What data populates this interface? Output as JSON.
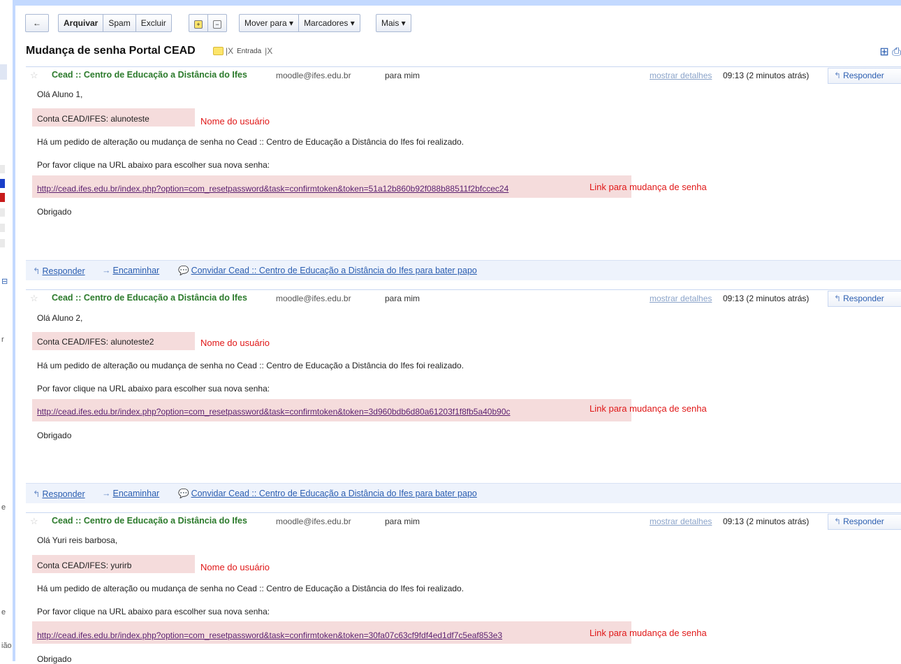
{
  "nav_fragments": [
    "ião",
    "e",
    "e",
    "r"
  ],
  "toolbar": {
    "back_glyph": "←",
    "archive": "Arquivar",
    "spam": "Spam",
    "delete": "Excluir",
    "expand_glyph": "+",
    "collapse_glyph": "−",
    "move_to": "Mover para ▾",
    "labels": "Marcadores ▾",
    "more": "Mais ▾"
  },
  "thread": {
    "subject": "Mudança de senha Portal CEAD",
    "label_x": "|X",
    "inbox_chip": "Entrada",
    "inbox_x": "|X",
    "view_icons": "⊞ ⎙"
  },
  "messages": [
    {
      "sender": "Cead :: Centro de Educação a Distância do Ifes",
      "email": "moodle@ifes.edu.br",
      "to": "para mim",
      "details": "mostrar detalhes",
      "time": "09:13 (2 minutos atrás)",
      "reply": "Responder",
      "greeting": "Olá Aluno 1,",
      "account": "Conta CEAD/IFES:  alunoteste",
      "account_note": "Nome do usuário",
      "request_text": "Há um pedido de alteração ou mudança de senha no Cead :: Centro de Educação a Distância do Ifes foi realizado.",
      "instruction": "Por favor clique na URL abaixo para escolher sua nova senha:",
      "link": "http://cead.ifes.edu.br/index.php?option=com_resetpassword&task=confirmtoken&token=51a12b860b92f088b88511f2bfccec24",
      "link_note": "Link para mudança de senha",
      "closing": "Obrigado",
      "footer_reply": "Responder",
      "footer_forward": "Encaminhar",
      "footer_chat": "Convidar Cead :: Centro de Educação a Distância do Ifes para bater papo"
    },
    {
      "sender": "Cead :: Centro de Educação a Distância do Ifes",
      "email": "moodle@ifes.edu.br",
      "to": "para mim",
      "details": "mostrar detalhes",
      "time": "09:13 (2 minutos atrás)",
      "reply": "Responder",
      "greeting": "Olá Aluno 2,",
      "account": "Conta CEAD/IFES:  alunoteste2",
      "account_note": "Nome do usuário",
      "request_text": "Há um pedido de alteração ou mudança de senha no Cead :: Centro de Educação a Distância do Ifes foi realizado.",
      "instruction": "Por favor clique na URL abaixo para escolher sua nova senha:",
      "link": "http://cead.ifes.edu.br/index.php?option=com_resetpassword&task=confirmtoken&token=3d960bdb6d80a61203f1f8fb5a40b90c",
      "link_note": "Link para mudança de senha",
      "closing": "Obrigado",
      "footer_reply": "Responder",
      "footer_forward": "Encaminhar",
      "footer_chat": "Convidar Cead :: Centro de Educação a Distância do Ifes para bater papo"
    },
    {
      "sender": "Cead :: Centro de Educação a Distância do Ifes",
      "email": "moodle@ifes.edu.br",
      "to": "para mim",
      "details": "mostrar detalhes",
      "time": "09:13 (2 minutos atrás)",
      "reply": "Responder",
      "greeting": "Olá Yuri reis barbosa,",
      "account": "Conta CEAD/IFES:  yurirb",
      "account_note": "Nome do usuário",
      "request_text": "Há um pedido de alteração ou mudança de senha no Cead :: Centro de Educação a Distância do Ifes foi realizado.",
      "instruction": "Por favor clique na URL abaixo para escolher sua nova senha:",
      "link": "http://cead.ifes.edu.br/index.php?option=com_resetpassword&task=confirmtoken&token=30fa07c63cf9fdf4ed1df7c5eaf853e3",
      "link_note": "Link para mudança de senha",
      "closing": "Obrigado"
    }
  ],
  "colors": {
    "accent_blue": "#c3d9ff",
    "sender_green": "#2b7a2b",
    "annotation_red": "#e01818",
    "highlight_pink": "#f5dcdc"
  }
}
